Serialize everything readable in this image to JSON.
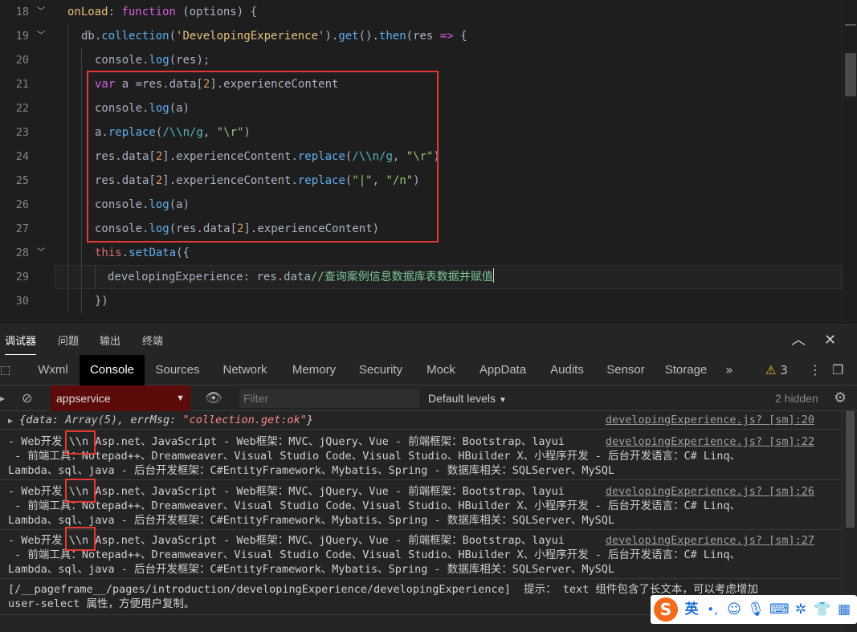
{
  "editor": {
    "lines": [
      {
        "no": "18",
        "fold": true
      },
      {
        "no": "19",
        "fold": true
      },
      {
        "no": "20"
      },
      {
        "no": "21"
      },
      {
        "no": "22"
      },
      {
        "no": "23"
      },
      {
        "no": "24"
      },
      {
        "no": "25"
      },
      {
        "no": "26"
      },
      {
        "no": "27"
      },
      {
        "no": "28",
        "fold": true
      },
      {
        "no": "29"
      },
      {
        "no": "30"
      }
    ],
    "code": {
      "l18": {
        "name": "onLoad",
        "colon": ": ",
        "kw": "function",
        "args": " (options) {"
      },
      "l19": {
        "obj": "db",
        "dot1": ".",
        "fn1": "collection",
        "p1": "(",
        "str": "'DevelopingExperience'",
        "p2": ").",
        "fn2": "get",
        "p3": "().",
        "fn3": "then",
        "p4": "(res ",
        "arrow": "=>",
        "p5": " {"
      },
      "l20": {
        "obj": "console",
        "dot": ".",
        "fn": "log",
        "rest": "(res);"
      },
      "l21": {
        "kw": "var",
        "rest1": " a =res.data[",
        "num": "2",
        "rest2": "].experienceContent"
      },
      "l22": {
        "obj": "console",
        "dot": ".",
        "fn": "log",
        "rest": "(a)"
      },
      "l23": {
        "pre": "a.",
        "fn": "replace",
        "p1": "(",
        "rx": "/\\\\n/g",
        "p2": ", ",
        "str": "\"\\r\"",
        "p3": ")"
      },
      "l24": {
        "pre1": "res.data[",
        "num": "2",
        "pre2": "].experienceContent.",
        "fn": "replace",
        "p1": "(",
        "rx": "/\\\\n/g",
        "p2": ", ",
        "str": "\"\\r\"",
        "p3": ")"
      },
      "l25": {
        "pre1": "res.data[",
        "num": "2",
        "pre2": "].experienceContent.",
        "fn": "replace",
        "p1": "(",
        "str1": "\"|\"",
        "p2": ", ",
        "str2": "\"/n\"",
        "p3": ")"
      },
      "l26": {
        "obj": "console",
        "dot": ".",
        "fn": "log",
        "rest": "(a)"
      },
      "l27": {
        "obj": "console",
        "dot": ".",
        "fn": "log",
        "rest1": "(res.data[",
        "num": "2",
        "rest2": "].experienceContent)"
      },
      "l28": {
        "this": "this",
        "dot": ".",
        "fn": "setData",
        "rest": "({"
      },
      "l29": {
        "key": "developingExperience",
        "colon": ": ",
        "val": "res.data",
        "comment": "//查询案例信息数据库表数据并赋值"
      },
      "l30": {
        "rest": "})"
      }
    }
  },
  "panel_tabs": [
    "调试器",
    "问题",
    "输出",
    "终端"
  ],
  "devtools_tabs": [
    "Wxml",
    "Console",
    "Sources",
    "Network",
    "Memory",
    "Security",
    "Mock",
    "AppData",
    "Audits",
    "Sensor",
    "Storage"
  ],
  "devtools_active": "Console",
  "warnings_count": "3",
  "toolbar": {
    "context": "appservice",
    "filter_placeholder": "Filter",
    "levels": "Default levels",
    "hidden": "2 hidden"
  },
  "console": {
    "entry1": {
      "k1": "data",
      "v1": "Array(5)",
      "k2": "errMsg",
      "v2": "\"collection.get:ok\"",
      "src": "developingExperience.js? [sm]:20"
    },
    "log_line1": "- Web开发|\\\\n Asp.net、JavaScript - Web框架：MVC、jQuery、Vue - 前端框架：Bootstrap、layui",
    "log_line2": " - 前端工具：Notepad++、Dreamweaver、Visual Studio Code、Visual Studio、HBuilder X、小程序开发 - 后台开发语言：C# Linq、",
    "log_line3": "Lambda、sql、java - 后台开发框架：C#EntityFramework、Mybatis、Spring - 数据库相关：SQLServer、MySQL",
    "src22": "developingExperience.js? [sm]:22",
    "src26": "developingExperience.js? [sm]:26",
    "src27": "developingExperience.js? [sm]:27",
    "last_line1": "[/__pageframe__/pages/introduction/developingExperience/developingExperience]  提示： text 组件包含了长文本，可以考虑增加",
    "last_line2": "user-select 属性，方便用户复制。"
  },
  "ime": {
    "lang": "英",
    "punct": "•,"
  },
  "colors": {
    "accent_red": "#e53935",
    "bg": "#1e1e1e",
    "context_bg": "#5c0a0a",
    "ime_logo": "#f26a1b"
  }
}
